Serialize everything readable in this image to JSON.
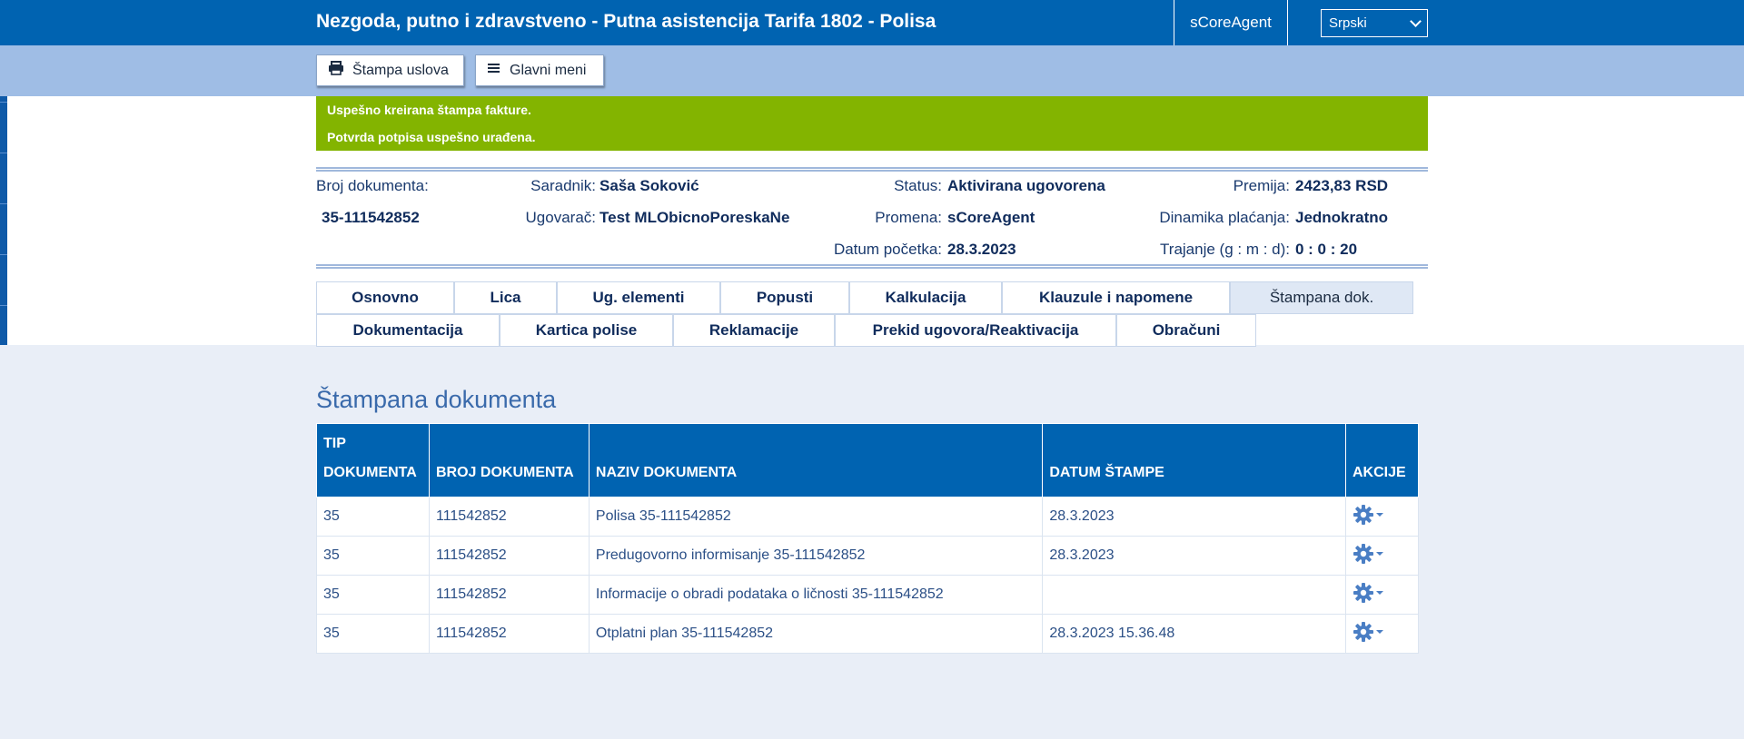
{
  "header": {
    "title": "Nezgoda, putno i zdravstveno - Putna asistencija Tarifa 1802 - Polisa",
    "agent": "sCoreAgent",
    "language": "Srpski"
  },
  "toolbar": {
    "print_label": "Štampa uslova",
    "menu_label": "Glavni meni"
  },
  "notices": [
    "Uspešno kreirana štampa fakture.",
    "Potvrda potpisa uspešno urađena."
  ],
  "summary": {
    "doc_number_label": "Broj dokumenta:",
    "doc_number": "35-111542852",
    "associate_label": "Saradnik:",
    "associate": "Saša Soković",
    "contractor_label": "Ugovarač:",
    "contractor": "Test MLObicnoPoreskaNe",
    "status_label": "Status:",
    "status": "Aktivirana ugovorena",
    "change_label": "Promena:",
    "change": "sCoreAgent",
    "start_label": "Datum početka:",
    "start": "28.3.2023",
    "premium_label": "Premija:",
    "premium": "2423,83 RSD",
    "payment_label": "Dinamika plaćanja:",
    "payment": "Jednokratno",
    "duration_label": "Trajanje (g : m : d):",
    "duration": "0 : 0 : 20"
  },
  "tabs": [
    "Osnovno",
    "Lica",
    "Ug. elementi",
    "Popusti",
    "Kalkulacija",
    "Klauzule i napomene",
    "Štampana dok.",
    "Dokumentacija",
    "Kartica polise",
    "Reklamacije",
    "Prekid ugovora/Reaktivacija",
    "Obračuni"
  ],
  "active_tab": "Štampana dok.",
  "section_title": "Štampana dokumenta",
  "table": {
    "headers": [
      "TIP DOKUMENTA",
      "BROJ DOKUMENTA",
      "NAZIV DOKUMENTA",
      "DATUM ŠTAMPE",
      "AKCIJE"
    ],
    "rows": [
      [
        "35",
        "111542852",
        "Polisa 35-111542852",
        "28.3.2023"
      ],
      [
        "35",
        "111542852",
        "Predugovorno informisanje 35-111542852",
        "28.3.2023"
      ],
      [
        "35",
        "111542852",
        "Informacije o obradi podataka o ličnosti 35-111542852",
        ""
      ],
      [
        "35",
        "111542852",
        "Otplatni plan 35-111542852",
        "28.3.2023 15.36.48"
      ]
    ]
  },
  "icons": {
    "print": "printer-icon",
    "menu": "menu-icon",
    "side": "list-icon",
    "actions": "gear-icon"
  },
  "colors": {
    "primary": "#0063b1",
    "toolbar": "#9fbde5",
    "success": "#83b400"
  }
}
